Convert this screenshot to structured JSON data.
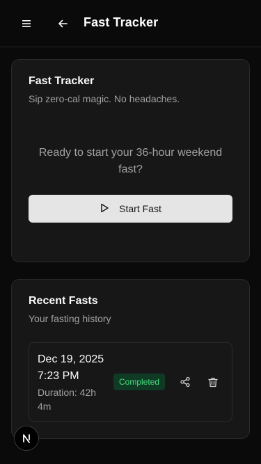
{
  "header": {
    "title": "Fast Tracker",
    "menu_icon": "hamburger-menu-icon",
    "back_icon": "arrow-left-icon"
  },
  "tracker": {
    "title": "Fast Tracker",
    "subtitle": "Sip zero-cal magic. No headaches.",
    "prompt": "Ready to start your 36-hour weekend fast?",
    "start_label": "Start Fast",
    "start_icon": "play-icon"
  },
  "history": {
    "title": "Recent Fasts",
    "subtitle": "Your fasting history",
    "items": [
      {
        "date": "Dec 19, 2025 7:23 PM",
        "duration": "Duration: 42h 4m",
        "status": "Completed",
        "share_icon": "share-icon",
        "delete_icon": "trash-icon"
      }
    ]
  },
  "badge": {
    "letter": "N"
  },
  "colors": {
    "background": "#0a0a0a",
    "card": "#171717",
    "status_green": "#4ade80",
    "status_bg": "#0f3a24",
    "button_bg": "#e5e5e5"
  }
}
